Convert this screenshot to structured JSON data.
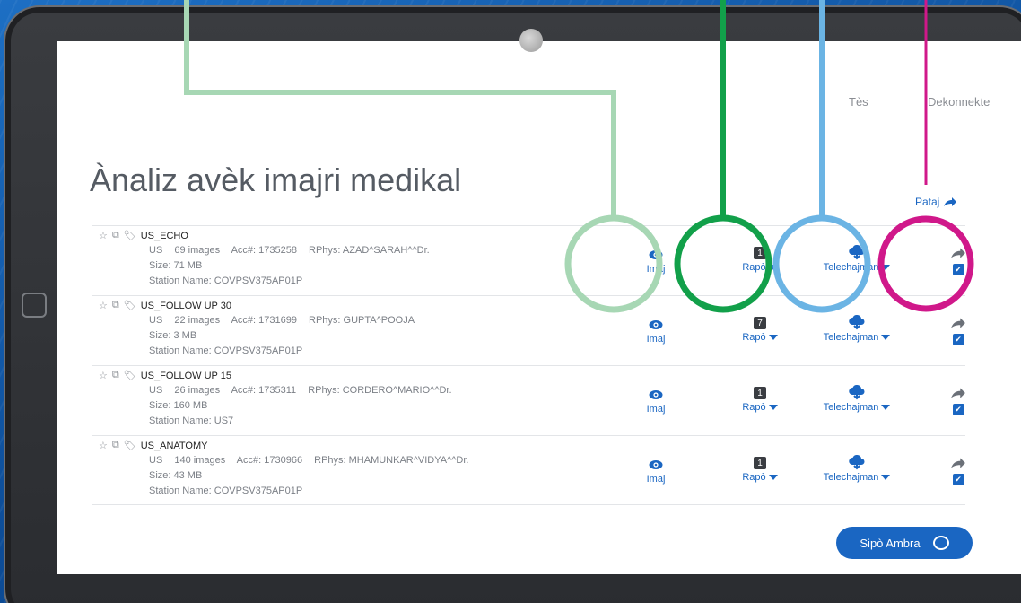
{
  "nav": {
    "test_label": "Tès",
    "logout_label": "Dekonnekte"
  },
  "page": {
    "title": "Ànaliz avèk imajri medikal",
    "share_label": "Pataj"
  },
  "actions": {
    "view_label": "Imaj",
    "report_label": "Rapò",
    "download_label": "Telechajman"
  },
  "studies": [
    {
      "name": "US_ECHO",
      "modality": "US",
      "images": "69 images",
      "acc": "Acc#: 1735258",
      "rphys": "RPhys: AZAD^SARAH^^Dr.",
      "size": "Size: 71 MB",
      "station": "Station Name:  COVPSV375AP01P",
      "report_count": "1"
    },
    {
      "name": "US_FOLLOW UP 30",
      "modality": "US",
      "images": "22 images",
      "acc": "Acc#: 1731699",
      "rphys": "RPhys: GUPTA^POOJA",
      "size": "Size: 3 MB",
      "station": "Station Name:  COVPSV375AP01P",
      "report_count": "7"
    },
    {
      "name": "US_FOLLOW UP 15",
      "modality": "US",
      "images": "26 images",
      "acc": "Acc#: 1735311",
      "rphys": "RPhys: CORDERO^MARIO^^Dr.",
      "size": "Size: 160 MB",
      "station": "Station Name:  US7",
      "report_count": "1"
    },
    {
      "name": "US_ANATOMY",
      "modality": "US",
      "images": "140 images",
      "acc": "Acc#: 1730966",
      "rphys": "RPhys: MHAMUNKAR^VIDYA^^Dr.",
      "size": "Size: 43 MB",
      "station": "Station Name:  COVPSV375AP01P",
      "report_count": "1"
    }
  ],
  "chat": {
    "label": "Sipò Ambra"
  },
  "colors": {
    "accent": "#1a66c2",
    "callout_view": "#a7d7b4",
    "callout_report": "#12a04a",
    "callout_download": "#6bb4e4",
    "callout_share": "#d0188a"
  }
}
